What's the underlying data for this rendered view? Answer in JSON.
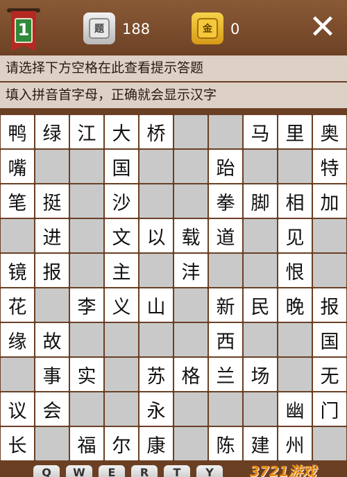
{
  "header": {
    "level_number": "1",
    "question_icon_label": "题",
    "question_count": "188",
    "gold_icon_label": "金",
    "gold_count": "0",
    "close_symbol": "✕"
  },
  "hints": [
    "请选择下方空格在此查看提示答题",
    "填入拼音首字母，正确就会显示汉字"
  ],
  "board": {
    "rows": [
      [
        "鸭",
        "绿",
        "江",
        "大",
        "桥",
        "",
        "",
        "马",
        "里",
        "奥"
      ],
      [
        "嘴",
        "",
        "",
        "国",
        "",
        "",
        "跆",
        "",
        "",
        "特"
      ],
      [
        "笔",
        "挺",
        "",
        "沙",
        "",
        "",
        "拳",
        "脚",
        "相",
        "加"
      ],
      [
        "",
        "进",
        "",
        "文",
        "以",
        "载",
        "道",
        "",
        "见",
        ""
      ],
      [
        "镜",
        "报",
        "",
        "主",
        "",
        "沣",
        "",
        "",
        "恨",
        ""
      ],
      [
        "花",
        "",
        "李",
        "义",
        "山",
        "",
        "新",
        "民",
        "晚",
        "报"
      ],
      [
        "缘",
        "故",
        "",
        "",
        "",
        "",
        "西",
        "",
        "",
        "国"
      ],
      [
        "",
        "事",
        "实",
        "",
        "苏",
        "格",
        "兰",
        "场",
        "",
        "无"
      ],
      [
        "议",
        "会",
        "",
        "",
        "永",
        "",
        "",
        "",
        "幽",
        "门"
      ],
      [
        "长",
        "",
        "福",
        "尔",
        "康",
        "",
        "陈",
        "建",
        "州",
        ""
      ]
    ],
    "empty_cells": [
      [
        0,
        5
      ],
      [
        0,
        6
      ],
      [
        1,
        1
      ],
      [
        1,
        2
      ],
      [
        1,
        4
      ],
      [
        1,
        5
      ],
      [
        1,
        7
      ],
      [
        1,
        8
      ],
      [
        2,
        2
      ],
      [
        2,
        4
      ],
      [
        2,
        5
      ],
      [
        3,
        0
      ],
      [
        3,
        2
      ],
      [
        3,
        7
      ],
      [
        3,
        9
      ],
      [
        4,
        2
      ],
      [
        4,
        4
      ],
      [
        4,
        6
      ],
      [
        4,
        7
      ],
      [
        4,
        9
      ],
      [
        5,
        1
      ],
      [
        5,
        5
      ],
      [
        6,
        2
      ],
      [
        6,
        3
      ],
      [
        6,
        4
      ],
      [
        6,
        5
      ],
      [
        6,
        7
      ],
      [
        6,
        8
      ],
      [
        7,
        0
      ],
      [
        7,
        3
      ],
      [
        7,
        8
      ],
      [
        8,
        2
      ],
      [
        8,
        3
      ],
      [
        8,
        5
      ],
      [
        8,
        6
      ],
      [
        8,
        7
      ],
      [
        9,
        1
      ],
      [
        9,
        5
      ],
      [
        9,
        9
      ]
    ]
  },
  "keys": [
    "Q",
    "W",
    "E",
    "R",
    "T",
    "Y"
  ],
  "watermark": "3721游戏",
  "colors": {
    "background": "#6b3f24",
    "hint_bar": "#ddd0c5",
    "cell_filled": "#ffffff",
    "cell_empty": "#c9c9c9"
  }
}
